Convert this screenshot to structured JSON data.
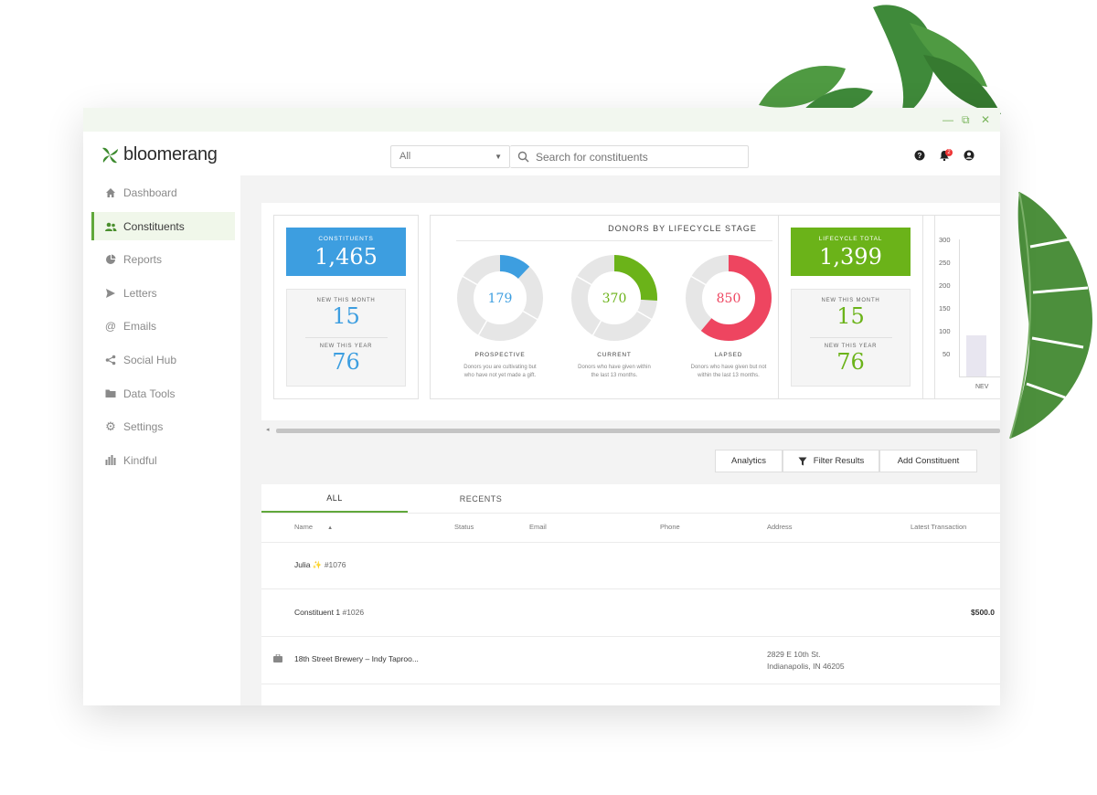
{
  "window": {
    "controls": [
      "—",
      "⧉",
      "✕"
    ]
  },
  "brand": {
    "name": "bloomerang"
  },
  "search": {
    "scope": "All",
    "placeholder": "Search for constituents"
  },
  "header_icons": [
    "help-icon",
    "bell-icon",
    "user-icon"
  ],
  "notifications": {
    "count": "2"
  },
  "sidebar": {
    "items": [
      {
        "label": "Dashboard",
        "icon": "home-icon"
      },
      {
        "label": "Constituents",
        "icon": "people-icon",
        "active": true
      },
      {
        "label": "Reports",
        "icon": "pie-icon"
      },
      {
        "label": "Letters",
        "icon": "send-icon"
      },
      {
        "label": "Emails",
        "icon": "at-icon"
      },
      {
        "label": "Social Hub",
        "icon": "share-icon"
      },
      {
        "label": "Data Tools",
        "icon": "folder-icon"
      },
      {
        "label": "Settings",
        "icon": "gear-icon"
      },
      {
        "label": "Kindful",
        "icon": "bars-icon"
      }
    ]
  },
  "constituents_card": {
    "label": "CONSTITUENTS",
    "total": "1,465",
    "new_month_label": "NEW THIS MONTH",
    "new_month": "15",
    "new_year_label": "NEW THIS YEAR",
    "new_year": "76",
    "color": "#3d9ee0"
  },
  "lifecycle": {
    "title": "DONORS BY LIFECYCLE STAGE",
    "stages": [
      {
        "label": "PROSPECTIVE",
        "value": "179",
        "fraction": 0.12,
        "color": "#3d9ee0",
        "desc_1": "Donors you are cultivating but",
        "desc_2": "who have not yet made a gift."
      },
      {
        "label": "CURRENT",
        "value": "370",
        "fraction": 0.26,
        "color": "#6bb319",
        "desc_1": "Donors who have given within",
        "desc_2": "the last 13 months."
      },
      {
        "label": "LAPSED",
        "value": "850",
        "fraction": 0.61,
        "color": "#ee4560",
        "desc_1": "Donors who have given but not",
        "desc_2": "within the last 13 months."
      }
    ]
  },
  "lifecycle_total_card": {
    "label": "LIFECYCLE TOTAL",
    "total": "1,399",
    "new_month_label": "NEW THIS MONTH",
    "new_month": "15",
    "new_year_label": "NEW THIS YEAR",
    "new_year": "76",
    "color": "#6bb319"
  },
  "mini_chart": {
    "ticks": [
      "300",
      "250",
      "200",
      "150",
      "100",
      "50"
    ],
    "xlabel_partial": "NEV"
  },
  "actions": {
    "analytics": "Analytics",
    "filter": "Filter Results",
    "add": "Add Constituent"
  },
  "tabs": {
    "all": "ALL",
    "recents": "RECENTS"
  },
  "columns": {
    "name": "Name",
    "status": "Status",
    "email": "Email",
    "phone": "Phone",
    "address": "Address",
    "latest": "Latest Transaction"
  },
  "rows": [
    {
      "name": "Julia",
      "emoji": "✨",
      "id": "#1076",
      "address_1": "",
      "address_2": "",
      "latest": ""
    },
    {
      "name": "Constituent 1",
      "emoji": "",
      "id": "#1026",
      "address_1": "",
      "address_2": "",
      "latest": "$500.0"
    },
    {
      "name": "18th Street Brewery – Indy Taproo...",
      "emoji": "",
      "id": "",
      "address_1": "2829 E 10th St.",
      "address_2": "Indianapolis, IN 46205",
      "latest": ""
    }
  ]
}
